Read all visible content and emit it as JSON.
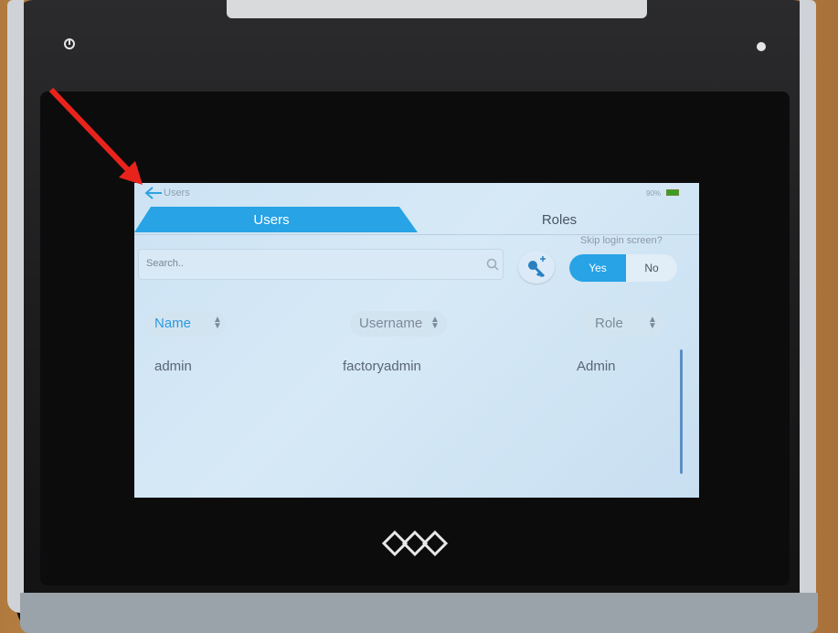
{
  "screen": {
    "title": "Users",
    "battery": "90%",
    "tabs": [
      {
        "label": "Users",
        "active": true
      },
      {
        "label": "Roles",
        "active": false
      }
    ],
    "search": {
      "placeholder": "Search.."
    },
    "skip_login": {
      "question": "Skip login screen?",
      "yes_label": "Yes",
      "no_label": "No",
      "selected": "Yes"
    },
    "columns": [
      {
        "label": "Name"
      },
      {
        "label": "Username"
      },
      {
        "label": "Role"
      }
    ],
    "rows": [
      {
        "name": "admin",
        "username": "factoryadmin",
        "role": "Admin"
      }
    ]
  },
  "colors": {
    "accent": "#27a3e6",
    "screen_bg": "#d0e5f5",
    "led": "#38e06a",
    "annotation_arrow": "#e8231c"
  },
  "icons": [
    "back-arrow-icon",
    "battery-icon",
    "search-icon",
    "add-key-icon",
    "sort-icon",
    "power-icon",
    "device-logo"
  ]
}
